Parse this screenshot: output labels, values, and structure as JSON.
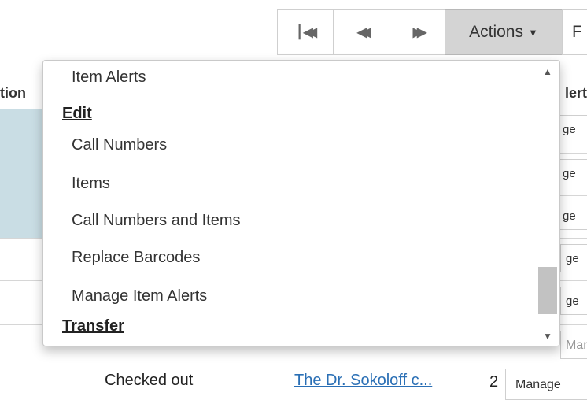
{
  "toolbar": {
    "first_glyph": "⏮",
    "prev_glyph": "⏪",
    "next_glyph": "⏩",
    "actions_label": "Actions",
    "clipped_label": "F"
  },
  "grid": {
    "header_left": "tion",
    "header_right": "lert",
    "manage_fragment": "ge",
    "behind_manage": "Manage",
    "last_row": {
      "status": "Checked out",
      "title": "The Dr. Sokoloff c...",
      "count": "2",
      "manage": "Manage"
    }
  },
  "menu": {
    "items": [
      {
        "label": "Item Alerts",
        "type": "item"
      },
      {
        "label": "Edit",
        "type": "header"
      },
      {
        "label": "Call Numbers",
        "type": "item"
      },
      {
        "label": "Items",
        "type": "item"
      },
      {
        "label": "Call Numbers and Items",
        "type": "item"
      },
      {
        "label": "Replace Barcodes",
        "type": "item"
      },
      {
        "label": "Manage Item Alerts",
        "type": "item"
      },
      {
        "label": "Transfer",
        "type": "header"
      }
    ]
  },
  "colors": {
    "link": "#2a6fb5",
    "row_tint": "#c9dde4",
    "actions_bg": "#d4d4d4"
  }
}
